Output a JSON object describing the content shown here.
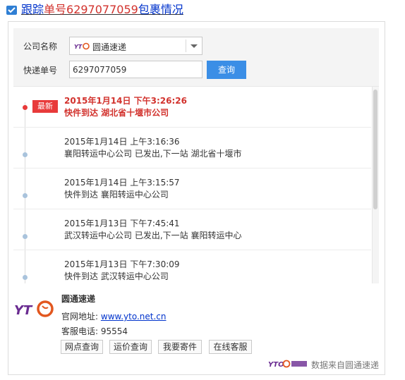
{
  "header": {
    "title_prefix": "跟踪",
    "title_red": "单号6297077059",
    "title_suffix": "包裹情况"
  },
  "form": {
    "company_label": "公司名称",
    "company_selected": "圆通速递",
    "number_label": "快递单号",
    "number_value": "6297077059",
    "query_button": "查询"
  },
  "tracking": {
    "latest_badge": "最新",
    "entries": [
      {
        "time": "2015年1月14日 下午3:26:26",
        "desc": "快件到达 湖北省十堰市公司",
        "latest": true
      },
      {
        "time": "2015年1月14日 上午3:16:36",
        "desc": "襄阳转运中心公司 已发出,下一站 湖北省十堰市"
      },
      {
        "time": "2015年1月14日 上午3:15:57",
        "desc": "快件到达 襄阳转运中心公司"
      },
      {
        "time": "2015年1月13日 下午7:45:41",
        "desc": "武汉转运中心公司 已发出,下一站 襄阳转运中心"
      },
      {
        "time": "2015年1月13日 下午7:30:09",
        "desc": "快件到达 武汉转运中心公司"
      }
    ]
  },
  "company_info": {
    "name": "圆通速递",
    "site_label": "官网地址:",
    "site_url": "www.yto.net.cn",
    "phone_label": "客服电话:",
    "phone": "95554",
    "buttons": [
      "网点查询",
      "运价查询",
      "我要寄件",
      "在线客服"
    ]
  },
  "footer": {
    "source_text": "数据来自圆通速递",
    "logo_text": "YTO"
  },
  "colors": {
    "accent_blue": "#3b8ee6",
    "latest_red": "#e83a3a",
    "link_blue": "#0033cc"
  },
  "icons": {
    "title": "express-box-icon",
    "dropdown": "chevron-down-icon"
  }
}
